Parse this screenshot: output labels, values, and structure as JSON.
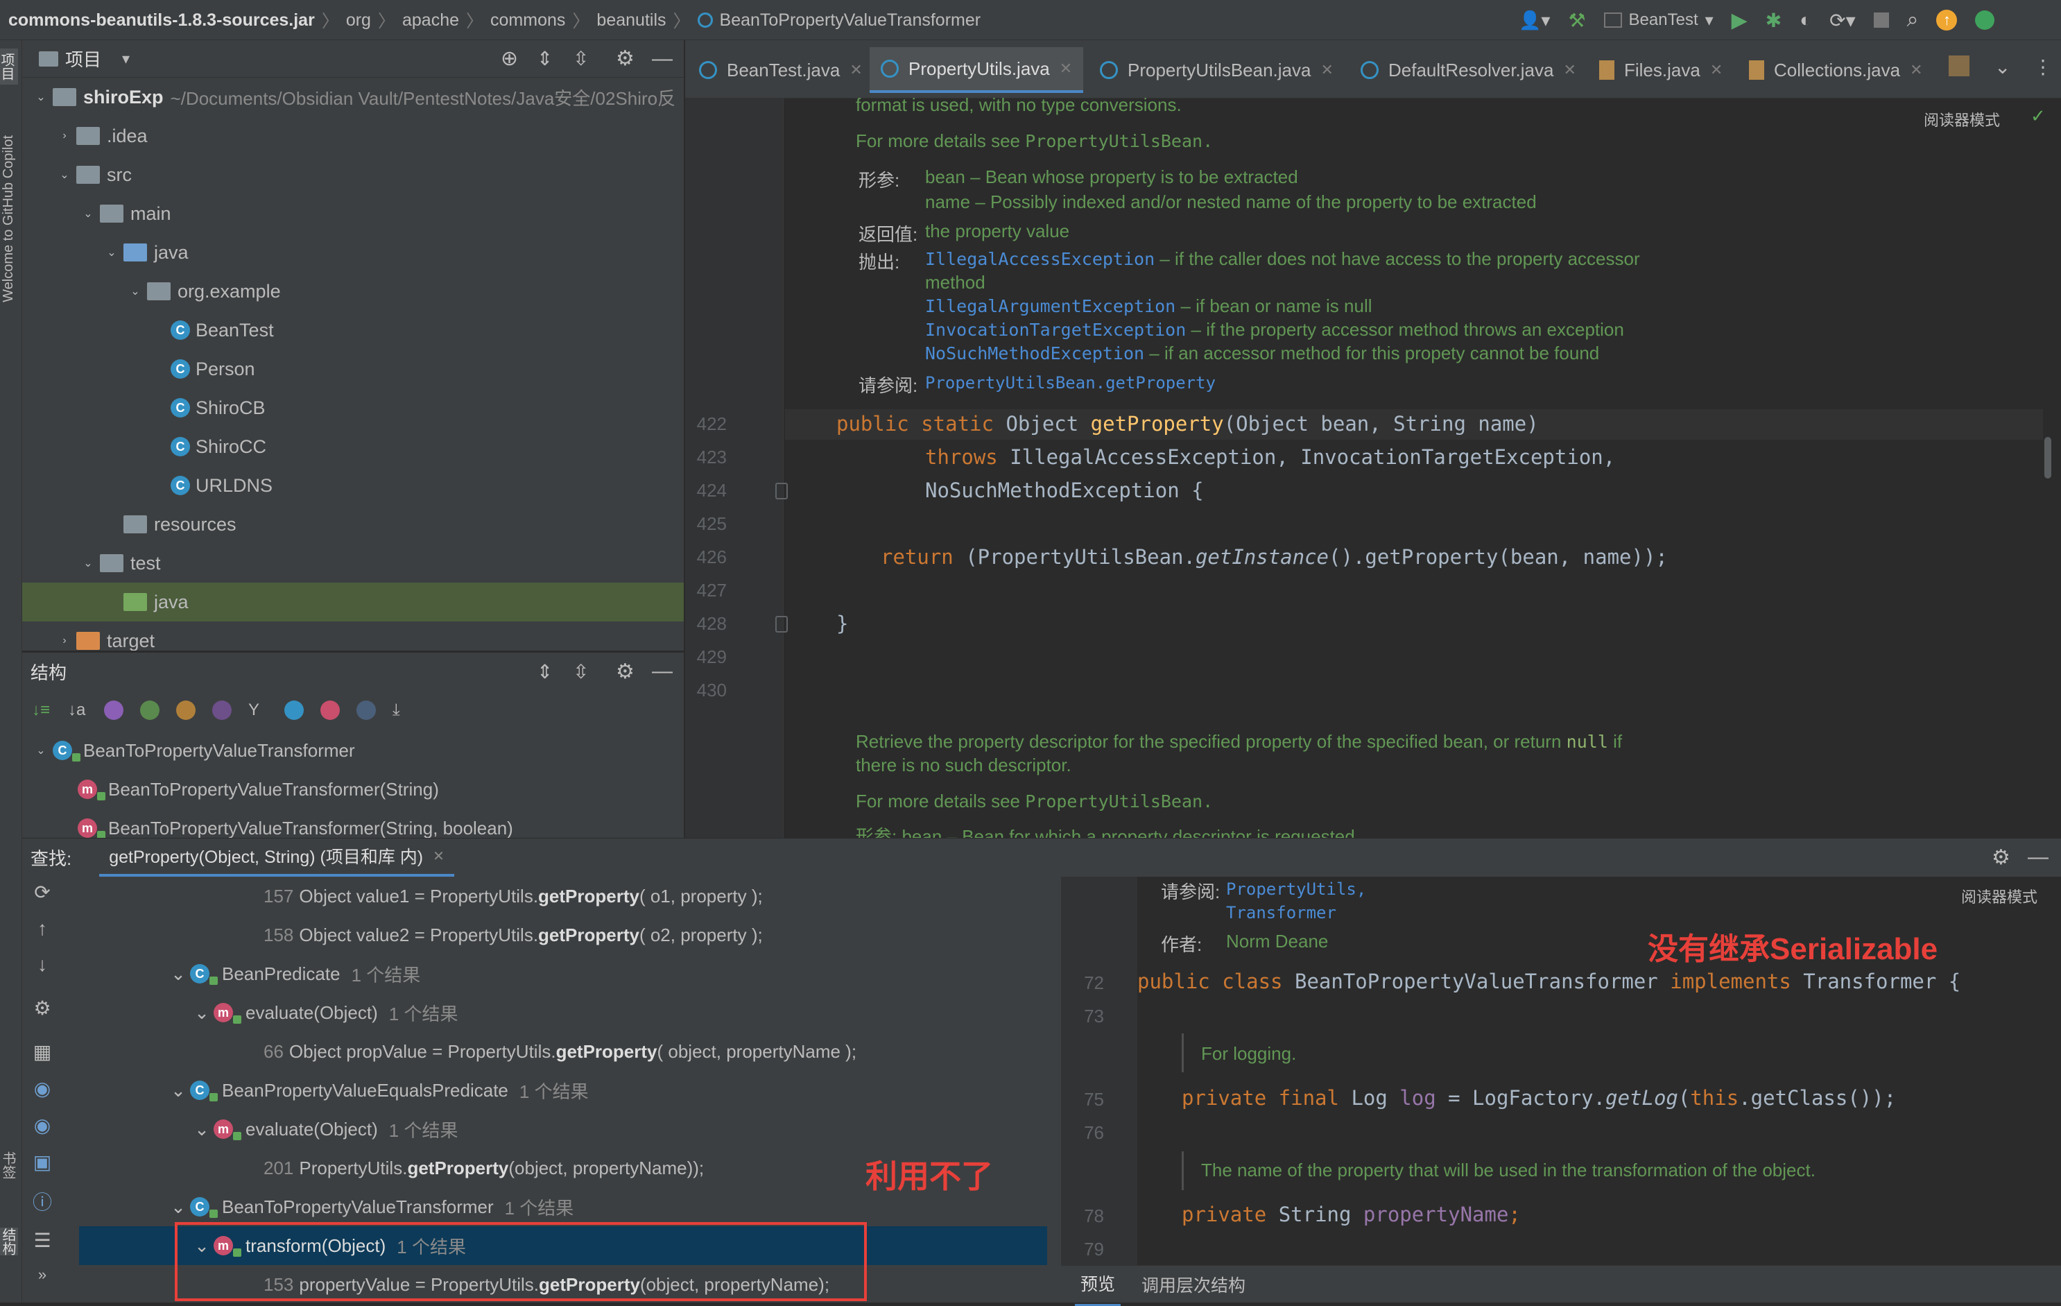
{
  "breadcrumb": {
    "items": [
      "commons-beanutils-1.8.3-sources.jar",
      "org",
      "apache",
      "commons",
      "beanutils",
      "BeanToPropertyValueTransformer"
    ],
    "run_config": "BeanTest"
  },
  "left_strip": {
    "top_label": "项目",
    "copilot": "Welcome to GitHub Copilot",
    "bottom1": "书签",
    "bottom2": "结构"
  },
  "project": {
    "header": "项目",
    "root_name": "shiroExp",
    "root_path": "~/Documents/Obsidian Vault/PentestNotes/Java安全/02Shiro反",
    "nodes": [
      ".idea",
      "src",
      "main",
      "java",
      "org.example",
      "BeanTest",
      "Person",
      "ShiroCB",
      "ShiroCC",
      "URLDNS",
      "resources",
      "test",
      "java",
      "target"
    ]
  },
  "structure": {
    "header": "结构",
    "items": [
      "BeanToPropertyValueTransformer",
      "BeanToPropertyValueTransformer(String)",
      "BeanToPropertyValueTransformer(String, boolean)"
    ]
  },
  "tabs": [
    "BeanTest.java",
    "PropertyUtils.java",
    "PropertyUtilsBean.java",
    "DefaultResolver.java",
    "Files.java",
    "Collections.java"
  ],
  "editor": {
    "reader_mode": "阅读器模式",
    "doc_top": {
      "partial": "format is used, with no type conversions.",
      "more": "For more details see",
      "more_link": "PropertyUtilsBean.",
      "params_label": "形参:",
      "param1": "bean – Bean whose property is to be extracted",
      "param2": "name – Possibly indexed and/or nested name of the property to be extracted",
      "returns_label": "返回值:",
      "returns": "the property value",
      "throws_label": "抛出:",
      "ex1": "IllegalAccessException",
      "ex1_desc": " – if the caller does not have access to the property accessor",
      "ex1_desc2": "method",
      "ex2": "IllegalArgumentException",
      "ex2_desc": " – if bean or name is null",
      "ex3": "InvocationTargetException",
      "ex3_desc": " – if the property accessor method throws an exception",
      "ex4": "NoSuchMethodException",
      "ex4_desc": " – if an accessor method for this propety cannot be found",
      "see_label": "请参阅:",
      "see": "PropertyUtilsBean.getProperty"
    },
    "line_numbers": [
      "422",
      "423",
      "424",
      "425",
      "426",
      "427",
      "428",
      "429",
      "430"
    ],
    "code": {
      "l422_kw": "public static ",
      "l422_t": "Object ",
      "l422_fn": "getProperty",
      "l422_rest": "(Object bean, String name)",
      "l423_kw": "throws ",
      "l423_rest": "IllegalAccessException, InvocationTargetException,",
      "l424": "NoSuchMethodException {",
      "l426_kw": "return ",
      "l426_a": "(PropertyUtilsBean.",
      "l426_it": "getInstance",
      "l426_b": "().getProperty(bean, name));",
      "l428": "}"
    },
    "doc_bottom": {
      "line1a": "Retrieve the property descriptor for the specified property of the specified bean, or return",
      "line1_null": "null",
      "line1b": "if",
      "line2": "there is no such descriptor.",
      "more": "For more details see",
      "more_link": "PropertyUtilsBean.",
      "params_cut": "形参:      bean – Bean for which a property descriptor is requested"
    }
  },
  "find": {
    "label": "查找:",
    "tab": "getProperty(Object, String) (项目和库 内)",
    "results": [
      {
        "num": "157",
        "a": "Object value1 = PropertyUtils.",
        "m": "getProperty",
        "b": "( o1, property );"
      },
      {
        "num": "158",
        "a": "Object value2 = PropertyUtils.",
        "m": "getProperty",
        "b": "( o2, property );"
      },
      {
        "name": "BeanPredicate",
        "count": "1 个结果"
      },
      {
        "name": "evaluate(Object)",
        "count": "1 个结果"
      },
      {
        "num": "66",
        "a": "Object propValue = PropertyUtils.",
        "m": "getProperty",
        "b": "( object, propertyName );"
      },
      {
        "name": "BeanPropertyValueEqualsPredicate",
        "count": "1 个结果"
      },
      {
        "name": "evaluate(Object)",
        "count": "1 个结果"
      },
      {
        "num": "201",
        "a": "PropertyUtils.",
        "m": "getProperty",
        "b": "(object, propertyName));"
      },
      {
        "name": "BeanToPropertyValueTransformer",
        "count": "1 个结果"
      },
      {
        "name": "transform(Object)",
        "count": "1 个结果"
      },
      {
        "num": "153",
        "a": "propertyValue = PropertyUtils.",
        "m": "getProperty",
        "b": "(object, propertyName);"
      }
    ],
    "annotation_left": "利用不了"
  },
  "preview": {
    "reader_mode": "阅读器模式",
    "see_label": "请参阅:",
    "see1": "PropertyUtils,",
    "see2": "Transformer",
    "author_label": "作者:",
    "author": "Norm Deane",
    "annotation": "没有继承Serializable",
    "line_numbers": [
      "72",
      "73",
      "75",
      "76",
      "78",
      "79"
    ],
    "l72_kw": "public class ",
    "l72_name": "BeanToPropertyValueTransformer ",
    "l72_kw2": "implements ",
    "l72_rest": "Transformer {",
    "doc1": "For logging.",
    "l75_kw": "private final ",
    "l75_t": "Log ",
    "l75_f": "log",
    "l75_a": " = LogFactory.",
    "l75_it": "getLog",
    "l75_b": "(",
    "l75_this": "this",
    "l75_c": ".getClass());",
    "doc2": "The name of the property that will be used in the transformation of the object.",
    "l78_kw": "private ",
    "l78_t": "String ",
    "l78_f": "propertyName",
    "l78_end": ";",
    "bottom_tabs": [
      "预览",
      "调用层次结构"
    ]
  },
  "colors": {
    "accent": "#3592c4",
    "annotation_red": "#e8403a",
    "selection": "#0d3a58",
    "selected_row": "#4b5d3b"
  }
}
